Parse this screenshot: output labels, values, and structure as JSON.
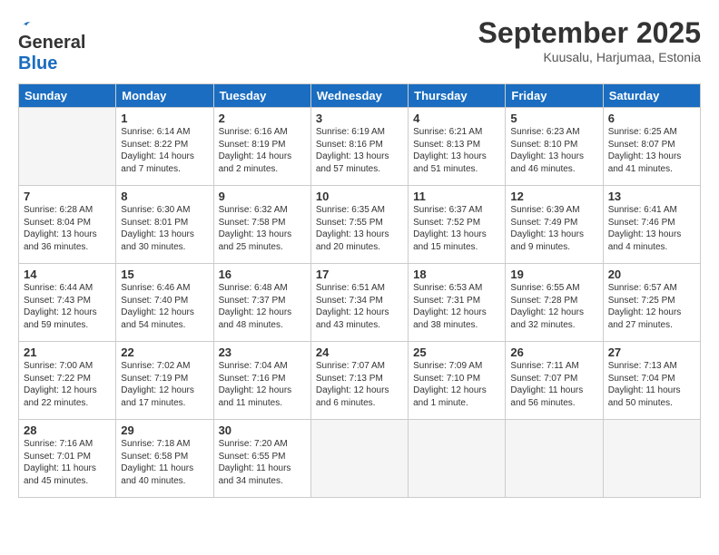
{
  "header": {
    "logo_line1": "General",
    "logo_line2": "Blue",
    "month": "September 2025",
    "location": "Kuusalu, Harjumaa, Estonia"
  },
  "weekdays": [
    "Sunday",
    "Monday",
    "Tuesday",
    "Wednesday",
    "Thursday",
    "Friday",
    "Saturday"
  ],
  "weeks": [
    [
      {
        "day": "",
        "detail": ""
      },
      {
        "day": "1",
        "detail": "Sunrise: 6:14 AM\nSunset: 8:22 PM\nDaylight: 14 hours\nand 7 minutes."
      },
      {
        "day": "2",
        "detail": "Sunrise: 6:16 AM\nSunset: 8:19 PM\nDaylight: 14 hours\nand 2 minutes."
      },
      {
        "day": "3",
        "detail": "Sunrise: 6:19 AM\nSunset: 8:16 PM\nDaylight: 13 hours\nand 57 minutes."
      },
      {
        "day": "4",
        "detail": "Sunrise: 6:21 AM\nSunset: 8:13 PM\nDaylight: 13 hours\nand 51 minutes."
      },
      {
        "day": "5",
        "detail": "Sunrise: 6:23 AM\nSunset: 8:10 PM\nDaylight: 13 hours\nand 46 minutes."
      },
      {
        "day": "6",
        "detail": "Sunrise: 6:25 AM\nSunset: 8:07 PM\nDaylight: 13 hours\nand 41 minutes."
      }
    ],
    [
      {
        "day": "7",
        "detail": "Sunrise: 6:28 AM\nSunset: 8:04 PM\nDaylight: 13 hours\nand 36 minutes."
      },
      {
        "day": "8",
        "detail": "Sunrise: 6:30 AM\nSunset: 8:01 PM\nDaylight: 13 hours\nand 30 minutes."
      },
      {
        "day": "9",
        "detail": "Sunrise: 6:32 AM\nSunset: 7:58 PM\nDaylight: 13 hours\nand 25 minutes."
      },
      {
        "day": "10",
        "detail": "Sunrise: 6:35 AM\nSunset: 7:55 PM\nDaylight: 13 hours\nand 20 minutes."
      },
      {
        "day": "11",
        "detail": "Sunrise: 6:37 AM\nSunset: 7:52 PM\nDaylight: 13 hours\nand 15 minutes."
      },
      {
        "day": "12",
        "detail": "Sunrise: 6:39 AM\nSunset: 7:49 PM\nDaylight: 13 hours\nand 9 minutes."
      },
      {
        "day": "13",
        "detail": "Sunrise: 6:41 AM\nSunset: 7:46 PM\nDaylight: 13 hours\nand 4 minutes."
      }
    ],
    [
      {
        "day": "14",
        "detail": "Sunrise: 6:44 AM\nSunset: 7:43 PM\nDaylight: 12 hours\nand 59 minutes."
      },
      {
        "day": "15",
        "detail": "Sunrise: 6:46 AM\nSunset: 7:40 PM\nDaylight: 12 hours\nand 54 minutes."
      },
      {
        "day": "16",
        "detail": "Sunrise: 6:48 AM\nSunset: 7:37 PM\nDaylight: 12 hours\nand 48 minutes."
      },
      {
        "day": "17",
        "detail": "Sunrise: 6:51 AM\nSunset: 7:34 PM\nDaylight: 12 hours\nand 43 minutes."
      },
      {
        "day": "18",
        "detail": "Sunrise: 6:53 AM\nSunset: 7:31 PM\nDaylight: 12 hours\nand 38 minutes."
      },
      {
        "day": "19",
        "detail": "Sunrise: 6:55 AM\nSunset: 7:28 PM\nDaylight: 12 hours\nand 32 minutes."
      },
      {
        "day": "20",
        "detail": "Sunrise: 6:57 AM\nSunset: 7:25 PM\nDaylight: 12 hours\nand 27 minutes."
      }
    ],
    [
      {
        "day": "21",
        "detail": "Sunrise: 7:00 AM\nSunset: 7:22 PM\nDaylight: 12 hours\nand 22 minutes."
      },
      {
        "day": "22",
        "detail": "Sunrise: 7:02 AM\nSunset: 7:19 PM\nDaylight: 12 hours\nand 17 minutes."
      },
      {
        "day": "23",
        "detail": "Sunrise: 7:04 AM\nSunset: 7:16 PM\nDaylight: 12 hours\nand 11 minutes."
      },
      {
        "day": "24",
        "detail": "Sunrise: 7:07 AM\nSunset: 7:13 PM\nDaylight: 12 hours\nand 6 minutes."
      },
      {
        "day": "25",
        "detail": "Sunrise: 7:09 AM\nSunset: 7:10 PM\nDaylight: 12 hours\nand 1 minute."
      },
      {
        "day": "26",
        "detail": "Sunrise: 7:11 AM\nSunset: 7:07 PM\nDaylight: 11 hours\nand 56 minutes."
      },
      {
        "day": "27",
        "detail": "Sunrise: 7:13 AM\nSunset: 7:04 PM\nDaylight: 11 hours\nand 50 minutes."
      }
    ],
    [
      {
        "day": "28",
        "detail": "Sunrise: 7:16 AM\nSunset: 7:01 PM\nDaylight: 11 hours\nand 45 minutes."
      },
      {
        "day": "29",
        "detail": "Sunrise: 7:18 AM\nSunset: 6:58 PM\nDaylight: 11 hours\nand 40 minutes."
      },
      {
        "day": "30",
        "detail": "Sunrise: 7:20 AM\nSunset: 6:55 PM\nDaylight: 11 hours\nand 34 minutes."
      },
      {
        "day": "",
        "detail": ""
      },
      {
        "day": "",
        "detail": ""
      },
      {
        "day": "",
        "detail": ""
      },
      {
        "day": "",
        "detail": ""
      }
    ]
  ]
}
